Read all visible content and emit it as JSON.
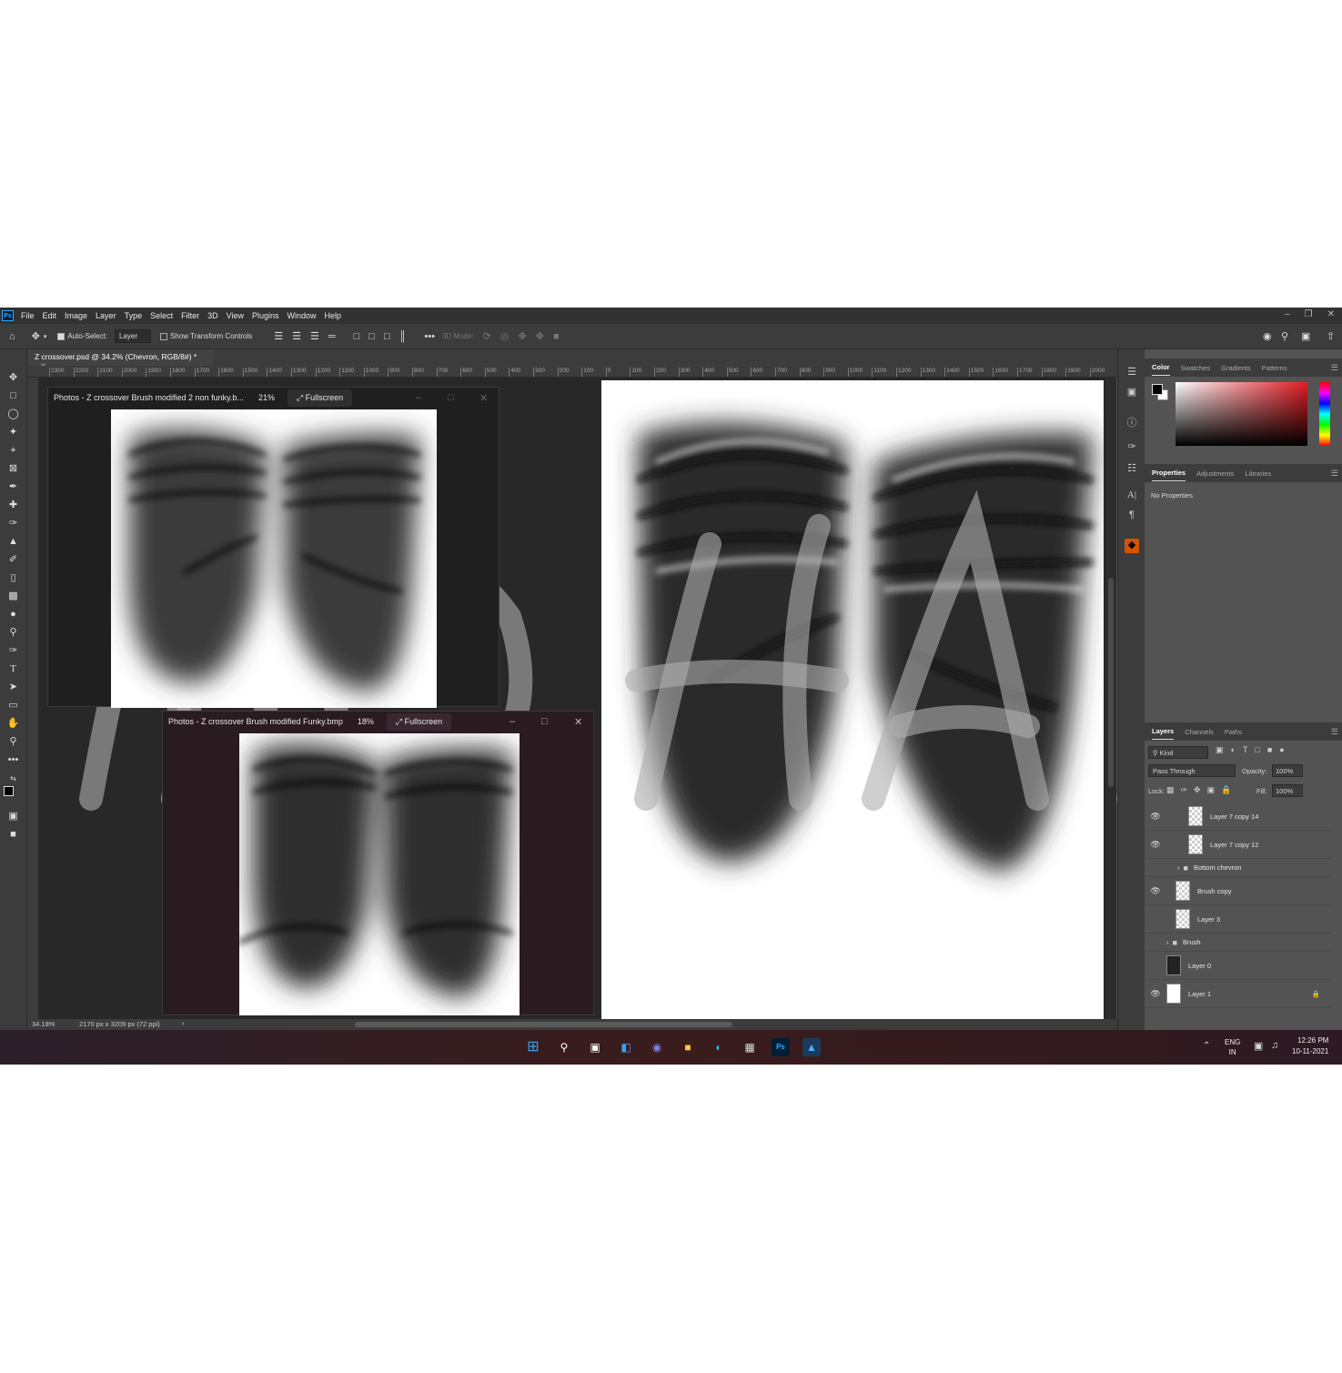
{
  "app": {
    "logo": "Ps",
    "menu": [
      "File",
      "Edit",
      "Image",
      "Layer",
      "Type",
      "Select",
      "Filter",
      "3D",
      "View",
      "Plugins",
      "Window",
      "Help"
    ]
  },
  "options_bar": {
    "auto_select_label": "Auto-Select:",
    "auto_select_value": "Layer",
    "show_transform_label": "Show Transform Controls",
    "mode_3d_label": "3D Mode:"
  },
  "document": {
    "tab_title": "Z crossover.psd @ 34.2% (Chevron, RGB/8#) *",
    "zoom_status": "34.18%",
    "size_status": "2170 px x 3209 px (72 ppi)"
  },
  "ruler_ticks": [
    "2300",
    "2200",
    "2100",
    "2000",
    "1900",
    "1800",
    "1700",
    "1600",
    "1500",
    "1400",
    "1300",
    "1200",
    "1100",
    "1000",
    "900",
    "800",
    "700",
    "600",
    "500",
    "400",
    "300",
    "200",
    "100",
    "0",
    "100",
    "200",
    "300",
    "400",
    "500",
    "600",
    "700",
    "800",
    "900",
    "1000",
    "1100",
    "1200",
    "1300",
    "1400",
    "1500",
    "1600",
    "1700",
    "1800",
    "1900",
    "2000"
  ],
  "photos_windows": [
    {
      "title": "Photos - Z crossover Brush modified 2 non funky.b...",
      "zoom": "21%",
      "fullscreen_label": "Fullscreen"
    },
    {
      "title": "Photos - Z crossover Brush modified Funky.bmp",
      "zoom": "18%",
      "fullscreen_label": "Fullscreen"
    }
  ],
  "color_panel": {
    "tabs": [
      "Color",
      "Swatches",
      "Gradients",
      "Patterns"
    ],
    "accent": "#e01b22"
  },
  "properties_panel": {
    "tabs": [
      "Properties",
      "Adjustments",
      "Libraries"
    ],
    "empty_text": "No Properties"
  },
  "layers_panel": {
    "tabs": [
      "Layers",
      "Channels",
      "Paths"
    ],
    "filter_label": "Kind",
    "blend_mode": "Pass Through",
    "opacity_label": "Opacity:",
    "opacity_value": "100%",
    "lock_label": "Lock:",
    "fill_label": "Fill:",
    "fill_value": "100%",
    "layers": [
      {
        "name": "Layer 7 copy 14",
        "type": "layer",
        "visible": true
      },
      {
        "name": "Layer 7 copy 12",
        "type": "layer",
        "visible": true
      },
      {
        "name": "Bottom chevron",
        "type": "group",
        "visible": false
      },
      {
        "name": "Brush copy",
        "type": "layer",
        "visible": true
      },
      {
        "name": "Layer 3",
        "type": "layer",
        "visible": false
      },
      {
        "name": "Brush",
        "type": "group",
        "visible": false
      },
      {
        "name": "Layer 0",
        "type": "layer",
        "visible": false
      },
      {
        "name": "Layer 1",
        "type": "layer",
        "visible": true,
        "locked": true
      }
    ]
  },
  "taskbar": {
    "language": "ENG",
    "region": "IN",
    "time": "12:26 PM",
    "date": "10-11-2021"
  }
}
